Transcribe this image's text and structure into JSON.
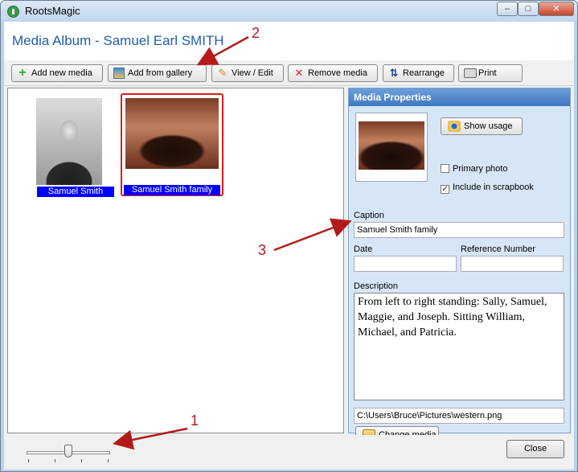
{
  "window": {
    "title": "RootsMagic",
    "min_glyph": "–",
    "max_glyph": "□",
    "close_glyph": "✕"
  },
  "page_title": "Media Album - Samuel Earl SMITH",
  "toolbar": {
    "add_new": "Add new media",
    "add_gallery": "Add from gallery",
    "view_edit": "View / Edit",
    "remove": "Remove media",
    "rearrange": "Rearrange",
    "print": "Print"
  },
  "gallery": {
    "items": [
      {
        "label": "Samuel Smith",
        "selected": false
      },
      {
        "label": "Samuel Smith family",
        "selected": true
      }
    ]
  },
  "properties": {
    "header": "Media Properties",
    "show_usage": "Show usage",
    "primary_photo": {
      "label": "Primary photo",
      "checked": false
    },
    "include_scrapbook": {
      "label": "Include in scrapbook",
      "checked": true,
      "check_glyph": "✓"
    },
    "caption_label": "Caption",
    "caption_value": "Samuel Smith family",
    "date_label": "Date",
    "date_value": "",
    "ref_label": "Reference Number",
    "ref_value": "",
    "description_label": "Description",
    "description_value": "From left to right standing: Sally, Samuel, Maggie, and Joseph.  Sitting William, Michael, and Patricia.",
    "file_path": "C:\\Users\\Bruce\\Pictures\\western.png",
    "change_media": "Change media"
  },
  "bottom": {
    "close": "Close",
    "zoom_slider_fraction": 0.5
  },
  "annotations": {
    "n1": "1",
    "n2": "2",
    "n3": "3",
    "color": "#b31b1b"
  }
}
